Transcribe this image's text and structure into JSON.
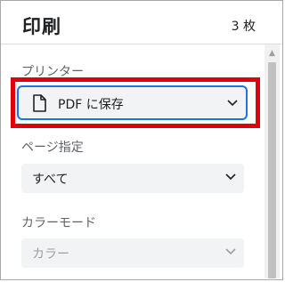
{
  "header": {
    "title": "印刷",
    "sheet_count": "3 枚"
  },
  "printer": {
    "label": "プリンター",
    "selected": "PDF に保存"
  },
  "pages": {
    "label": "ページ指定",
    "selected": "すべて"
  },
  "color_mode": {
    "label": "カラーモード",
    "selected": "カラー",
    "disabled": true
  },
  "icons": {
    "printer_icon": "document-icon",
    "dropdown_icon": "chevron-down-icon",
    "scroll_up_icon": "scroll-up-arrow-icon"
  },
  "colors": {
    "highlight_border": "#e0000e",
    "focus_border": "#1a73e8",
    "select_bg": "#f1f3f4"
  }
}
